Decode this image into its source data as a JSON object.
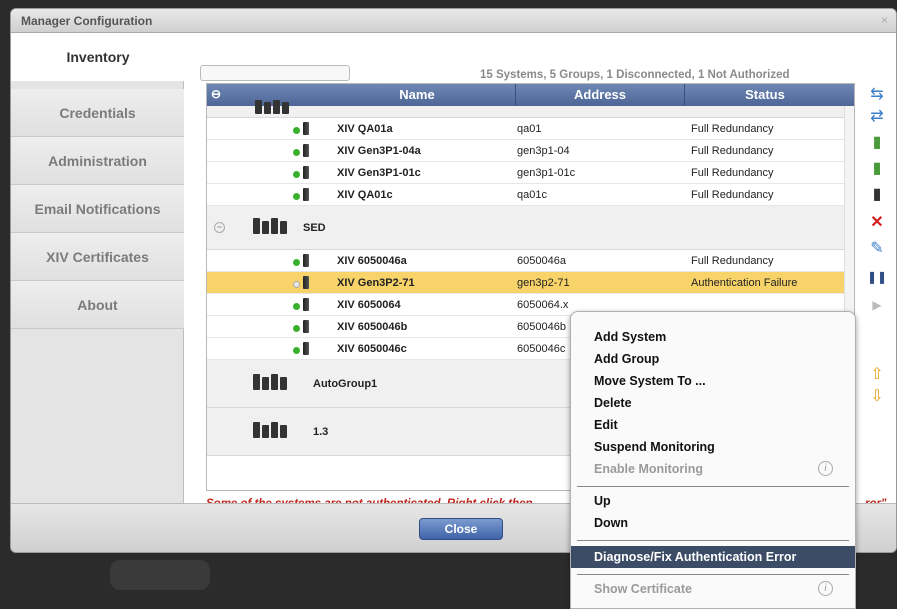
{
  "window": {
    "title": "Manager Configuration",
    "close_glyph": "×"
  },
  "tabs": [
    "Inventory",
    "Credentials",
    "Administration",
    "Email Notifications",
    "XIV Certificates",
    "About"
  ],
  "summary": "15 Systems, 5 Groups, 1 Disconnected, 1 Not Authorized",
  "table": {
    "columns": [
      "Name",
      "Address",
      "Status"
    ],
    "collapse_glyph": "⊖",
    "rows_group1": [
      {
        "name": "XIV QA01a",
        "address": "qa01",
        "status": "Full Redundancy"
      },
      {
        "name": "XIV Gen3P1-04a",
        "address": "gen3p1-04",
        "status": "Full Redundancy"
      },
      {
        "name": "XIV Gen3P1-01c",
        "address": "gen3p1-01c",
        "status": "Full Redundancy"
      },
      {
        "name": "XIV QA01c",
        "address": "qa01c",
        "status": "Full Redundancy"
      }
    ],
    "group_sed": "SED",
    "rows_sed": [
      {
        "name": "XIV 6050046a",
        "address": "6050046a",
        "status": "Full Redundancy"
      },
      {
        "name": "XIV Gen3P2-71",
        "address": "gen3p2-71",
        "status": "Authentication Failure"
      },
      {
        "name": "XIV 6050064",
        "address": "6050064.x",
        "status": ""
      },
      {
        "name": "XIV 6050046b",
        "address": "6050046b",
        "status": ""
      },
      {
        "name": "XIV 6050046c",
        "address": "6050046c",
        "status": ""
      }
    ],
    "group_auto": "AutoGroup1",
    "group_13": "1.3"
  },
  "error_message": "Some of the systems are not authenticated. Right click then",
  "error_tail": "ror\"",
  "close_button": "Close",
  "context_menu": {
    "items": [
      "Add System",
      "Add Group",
      "Move System To ...",
      "Delete",
      "Edit",
      "Suspend Monitoring"
    ],
    "disabled_item": "Enable Monitoring",
    "order_items": [
      "Up",
      "Down"
    ],
    "highlighted_item": "Diagnose/Fix Authentication Error",
    "certificate_item": "Show Certificate",
    "info_glyph": "i"
  },
  "toolbar_icons": [
    "import-icon",
    "export-icon",
    "add-system-icon",
    "add-group-icon",
    "move-icon",
    "delete-icon",
    "edit-icon",
    "pause-icon",
    "play-icon",
    "up-arrow-icon",
    "down-arrow-icon"
  ],
  "colors": {
    "header": "#5a72a4",
    "selected_row": "#f7d36a",
    "error_text": "#c0271f",
    "menu_highlight": "#3c4c66"
  }
}
